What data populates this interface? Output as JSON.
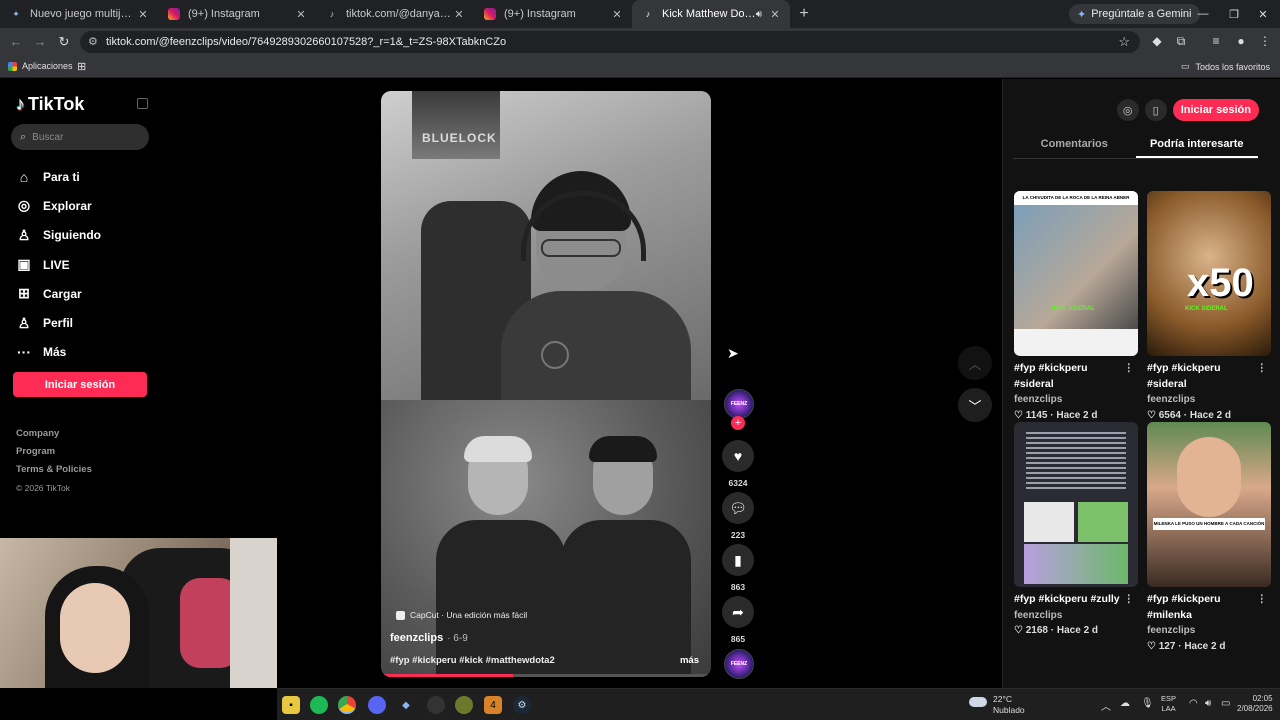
{
  "browser": {
    "tabs": [
      {
        "title": "Nuevo juego multijugador coop",
        "favicon": "sparkle-icon",
        "active": false
      },
      {
        "title": "(9+) Instagram",
        "favicon": "instagram-icon",
        "active": false
      },
      {
        "title": "tiktok.com/@danyahurtadoo/vi",
        "favicon": "tiktok-icon",
        "active": false
      },
      {
        "title": "(9+) Instagram",
        "favicon": "instagram-icon",
        "active": false
      },
      {
        "title": "Kick Matthew Dota: cómo e",
        "favicon": "tiktok-icon",
        "active": true
      }
    ],
    "gemini_label": "Pregúntale a Gemini",
    "url": "tiktok.com/@feenzclips/video/7649289302660107528?_r=1&_t=ZS-98XTabknCZo",
    "bookmarks": {
      "apps": "Aplicaciones",
      "all": "Todos los favoritos"
    }
  },
  "tiktok": {
    "logo": "TikTok",
    "search_placeholder": "Buscar",
    "nav": [
      {
        "label": "Para ti",
        "icon": "home-icon",
        "glyph": "⌂"
      },
      {
        "label": "Explorar",
        "icon": "compass-icon",
        "glyph": "◎"
      },
      {
        "label": "Siguiendo",
        "icon": "user-icon",
        "glyph": "♙"
      },
      {
        "label": "LIVE",
        "icon": "live-icon",
        "glyph": "▣"
      },
      {
        "label": "Cargar",
        "icon": "upload-icon",
        "glyph": "⊞"
      },
      {
        "label": "Perfil",
        "icon": "profile-icon",
        "glyph": "♙"
      },
      {
        "label": "Más",
        "icon": "more-icon",
        "glyph": "···"
      }
    ],
    "login_label": "Iniciar sesión",
    "footer": [
      "Company",
      "Program",
      "Terms & Policies"
    ],
    "copyright": "© 2026 TikTok"
  },
  "video": {
    "poster_text": "BLUELOCK",
    "capcut": "CapCut · Una edición más fácil",
    "author": "feenzclips",
    "date": "· 6-9",
    "tags": "#fyp #kickperu #kick #matthewdota2",
    "more": "más",
    "progress": 0.4,
    "avatar_text": "FEENZ",
    "likes": "6324",
    "comments": "223",
    "saves": "863",
    "shares": "865"
  },
  "right_panel": {
    "login_label": "Iniciar sesión",
    "tabs": [
      "Comentarios",
      "Podría interesarte"
    ],
    "cards": [
      {
        "title": "#fyp #kickperu #sideral",
        "author": "feenzclips",
        "likes": "1145",
        "age": "Hace 2 d",
        "kick_label": "KICK SIDERAL",
        "banner": "LA CHIVUDITA DE LA ROCA DE LA REINA ABNER"
      },
      {
        "title": "#fyp #kickperu #sideral",
        "author": "feenzclips",
        "likes": "6564",
        "age": "Hace 2 d",
        "kick_label": "KICK SIDERAL",
        "overlay": "x50"
      },
      {
        "title": "#fyp #kickperu #zully",
        "author": "feenzclips",
        "likes": "2168",
        "age": "Hace 2 d"
      },
      {
        "title": "#fyp #kickperu #milenka",
        "author": "feenzclips",
        "likes": "127",
        "age": "Hace 2 d",
        "caption": "MILENKA LE PUSO UN HOMBRE A CADA CANCIÓN"
      }
    ]
  },
  "taskbar": {
    "weather_temp": "22°C",
    "weather_desc": "Nublado",
    "lang1": "ESP",
    "lang2": "LAA",
    "time": "02:05",
    "date": "2/08/2026"
  },
  "colors": {
    "accent": "#fe2c55",
    "panel": "#121212",
    "chrome": "#35363a"
  }
}
